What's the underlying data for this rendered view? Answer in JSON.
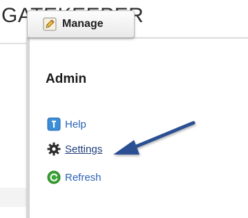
{
  "app": {
    "title": "GATEKEEPER"
  },
  "toolbar": {
    "manage_label": "Manage",
    "manage_icon": "pencil-icon"
  },
  "menu": {
    "section_title": "Admin",
    "items": [
      {
        "label": "Help",
        "icon": "help-icon"
      },
      {
        "label": "Settings",
        "icon": "gear-icon"
      },
      {
        "label": "Refresh",
        "icon": "refresh-icon"
      }
    ]
  },
  "colors": {
    "link": "#2b63b6",
    "link_active": "#1f3e7a",
    "arrow": "#2a4f92",
    "help_icon_bg": "#3a8fd8",
    "refresh_icon_bg": "#3aa335",
    "gear_icon": "#2b2b2b"
  }
}
